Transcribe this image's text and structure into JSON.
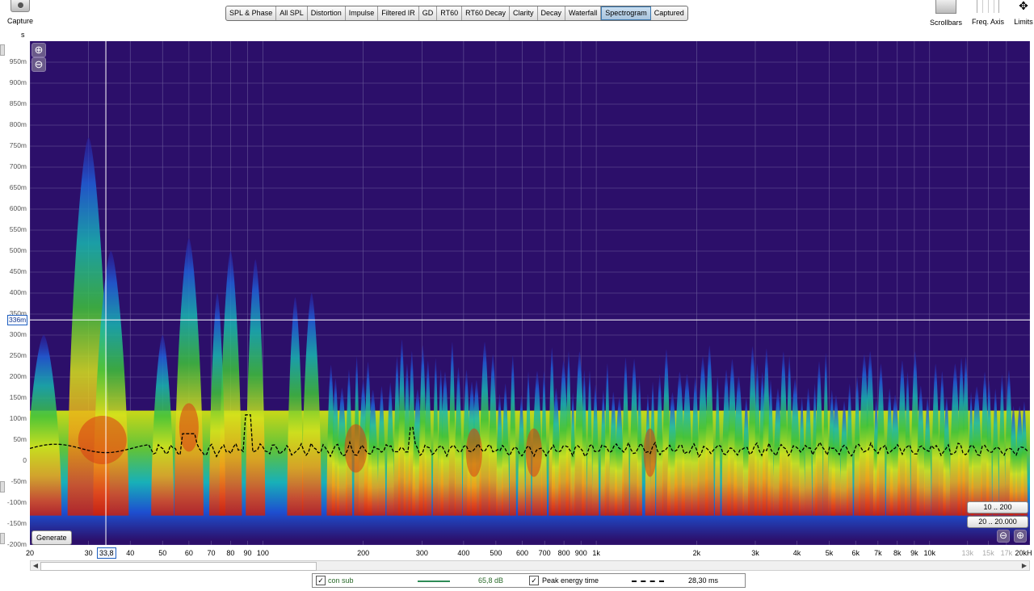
{
  "toolbar": {
    "capture_label": "Capture",
    "y_unit": "s",
    "tabs": [
      "SPL & Phase",
      "All SPL",
      "Distortion",
      "Impulse",
      "Filtered IR",
      "GD",
      "RT60",
      "RT60 Decay",
      "Clarity",
      "Decay",
      "Waterfall",
      "Spectrogram",
      "Captured"
    ],
    "active_tab": "Spectrogram",
    "scrollbars_label": "Scrollbars",
    "freq_axis_label": "Freq. Axis",
    "limits_label": "Limits"
  },
  "plot": {
    "y_ticks": [
      "950m",
      "900m",
      "850m",
      "800m",
      "750m",
      "700m",
      "650m",
      "600m",
      "550m",
      "500m",
      "450m",
      "400m",
      "350m",
      "300m",
      "250m",
      "200m",
      "150m",
      "100m",
      "50m",
      "0",
      "-50m",
      "-100m",
      "-150m",
      "-200m"
    ],
    "x_ticks": [
      "20",
      "30",
      "40",
      "50",
      "60",
      "70",
      "80",
      "90",
      "100",
      "200",
      "300",
      "400",
      "500",
      "600",
      "700",
      "800",
      "900",
      "1k",
      "2k",
      "3k",
      "4k",
      "5k",
      "6k",
      "7k",
      "8k",
      "9k",
      "10k",
      "13k",
      "15k",
      "17k",
      "20kH"
    ],
    "cursor_x_readout": "33,8",
    "cursor_y_readout": "336m",
    "zoom_in_icon": "zoom-in-icon",
    "zoom_out_icon": "zoom-out-icon",
    "generate_label": "Generate",
    "range_low_label": "10 .. 200",
    "range_full_label": "20 .. 20.000",
    "background_color": "#2c0f6a"
  },
  "legend": {
    "items": [
      {
        "checked": true,
        "name": "con sub",
        "value": "65,8 dB",
        "line_color": "#2e8b57"
      },
      {
        "checked": true,
        "name": "Peak energy time",
        "value": "28,30 ms",
        "line_color": "#000000"
      }
    ]
  }
}
